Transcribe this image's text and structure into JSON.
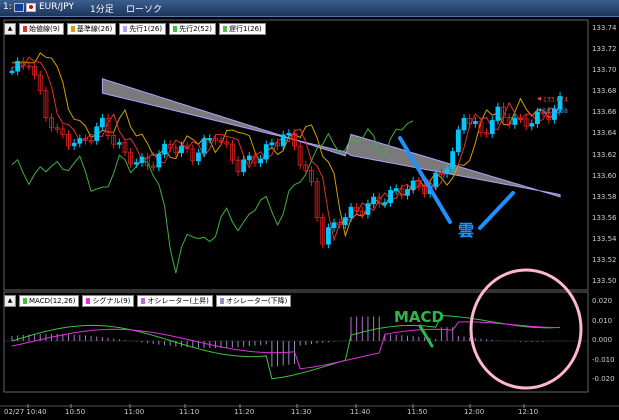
{
  "window": {
    "index": "1:",
    "symbol": "EUR/JPY",
    "timeframe": "1分足",
    "chart_style": "ローソク"
  },
  "main_legend": [
    {
      "label": "始値線(9)",
      "color": "#e03030"
    },
    {
      "label": "基準線(26)",
      "color": "#d4a000"
    },
    {
      "label": "先行1(26)",
      "color": "#b0a0ff"
    },
    {
      "label": "先行2(52)",
      "color": "#40c040"
    },
    {
      "label": "遅行1(26)",
      "color": "#50c050"
    }
  ],
  "sub_legend": [
    {
      "label": "MACD(12,26)",
      "color": "#40c040"
    },
    {
      "label": "シグナル(9)",
      "color": "#e030e0"
    },
    {
      "label": "オシレーター(上昇)",
      "color": "#b070d0"
    },
    {
      "label": "オシレーター(下降)",
      "color": "#9090c0"
    }
  ],
  "price_axis": [
    "133.74",
    "133.72",
    "133.70",
    "133.68",
    "133.66",
    "133.64",
    "133.62",
    "133.60",
    "133.58",
    "133.56",
    "133.54",
    "133.52",
    "133.50"
  ],
  "macd_axis": [
    "0.020",
    "0.010",
    "0.000",
    "-0.010",
    "-0.020"
  ],
  "time_axis": [
    "02/27 10:40",
    "10:50",
    "11:00",
    "11:10",
    "11:20",
    "11:30",
    "11:40",
    "11:50",
    "12:00",
    "12:10"
  ],
  "price_tags": {
    "upper": "133.674",
    "lower": "133.668"
  },
  "annotations": {
    "cloud": "雲",
    "macd": "MACD"
  },
  "colors": {
    "background": "#000000",
    "up_candle": "#00c8ff",
    "down_candle": "#e02020",
    "cloud": "#808080",
    "annotation": "#1e90ff",
    "circle": "#ffb6d0"
  }
}
